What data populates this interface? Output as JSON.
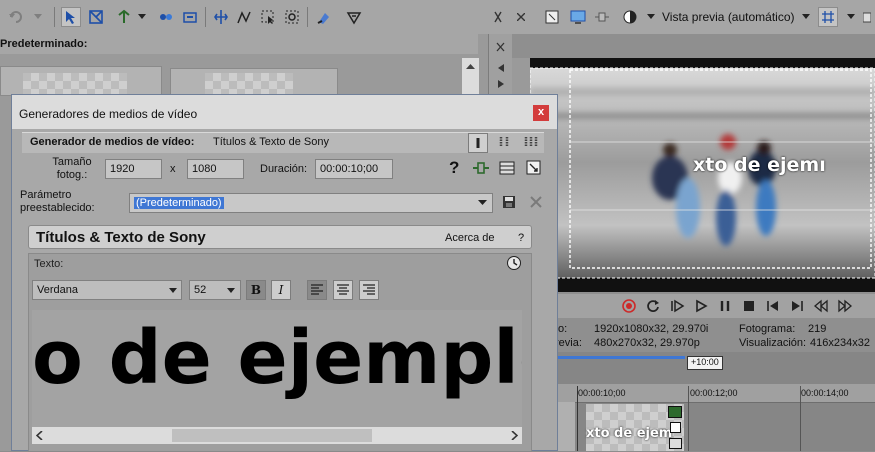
{
  "left_panel": {
    "preset_header": "Predeterminado:"
  },
  "preview": {
    "mode_label": "Vista previa (automático)",
    "overlay_text": "xto de ejemı",
    "info": {
      "project_label": "to:",
      "project_value": "1920x1080x32, 29.970i",
      "preview_label": "revia:",
      "preview_value": "480x270x32, 29.970p",
      "frame_label": "Fotograma:",
      "frame_value": "219",
      "display_label": "Visualización:",
      "display_value": "416x234x32"
    }
  },
  "timeline": {
    "offset_badge": "+10:00",
    "ticks": [
      "00:00:10;00",
      "00:00:12;00",
      "00:00:14;00"
    ],
    "clip_text": "xto de ejem"
  },
  "dialog": {
    "title": "Generadores de medios de vídeo",
    "close": "x",
    "generator_label": "Generador de medios de vídeo:",
    "generator_name": "Títulos & Texto de Sony",
    "frame_size_label": "Tamaño fotog.:",
    "width": "1920",
    "times": "x",
    "height": "1080",
    "duration_label": "Duración:",
    "duration": "00:00:10;00",
    "help": "?",
    "preset_label": "Parámetro preestablecido:",
    "preset_value": "(Predeterminado)"
  },
  "plugin": {
    "title": "Títulos & Texto de Sony",
    "about": "Acerca de",
    "help": "?",
    "text_label": "Texto:",
    "font": "Verdana",
    "size": "52",
    "bold": "B",
    "italic": "I",
    "sample_text": "o de ejemplo"
  },
  "colors": {
    "selection": "#3f77d4",
    "close_red": "#d33c3c",
    "record_red": "#cc2a2a"
  }
}
